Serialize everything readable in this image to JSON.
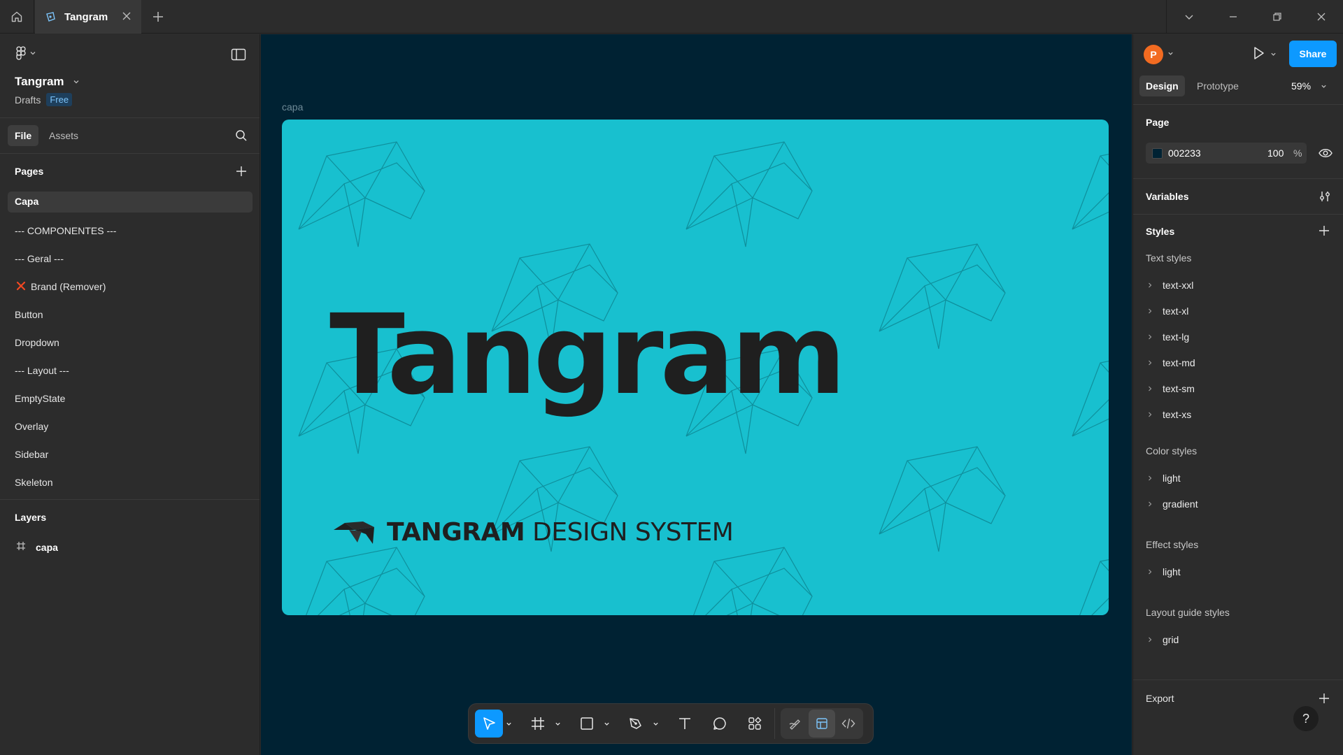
{
  "app": {
    "tab_title": "Tangram",
    "icons": [
      "home-icon",
      "figma-file-icon",
      "close-icon",
      "plus-icon",
      "chevron-down-icon",
      "minimize-icon",
      "restore-icon",
      "window-close-icon"
    ]
  },
  "left_panel": {
    "file_name": "Tangram",
    "location": "Drafts",
    "plan_badge": "Free",
    "tabs": {
      "file": "File",
      "assets": "Assets"
    },
    "pages_title": "Pages",
    "pages": [
      {
        "label": "Capa",
        "selected": true
      },
      {
        "label": "--- COMPONENTES ---"
      },
      {
        "label": "--- Geral ---"
      },
      {
        "label": "Brand (Remover)",
        "icon": "red-x-icon"
      },
      {
        "label": "Button"
      },
      {
        "label": "Dropdown"
      },
      {
        "label": "--- Layout ---"
      },
      {
        "label": "EmptyState"
      },
      {
        "label": "Overlay"
      },
      {
        "label": "Sidebar"
      },
      {
        "label": "Skeleton"
      }
    ],
    "layers_title": "Layers",
    "layers": [
      {
        "label": "capa",
        "icon": "frame-hash-icon"
      }
    ]
  },
  "canvas": {
    "background": "#002233",
    "frame_label": "capa",
    "frame_color": "#18c0cf",
    "title": "Tangram",
    "logo_bold": "TANGRAM",
    "logo_rest": " DESIGN SYSTEM"
  },
  "toolbar": {
    "tools": [
      "move-tool-icon",
      "frame-tool-icon",
      "rectangle-tool-icon",
      "pen-tool-icon",
      "text-tool-icon",
      "comment-tool-icon",
      "actions-icon"
    ],
    "active_tool": "move-tool-icon",
    "mode_tools": [
      "draw-mode-icon",
      "design-mode-icon",
      "dev-mode-icon"
    ]
  },
  "right_panel": {
    "avatar_initial": "P",
    "share_label": "Share",
    "tabs": {
      "design": "Design",
      "prototype": "Prototype"
    },
    "zoom": "59%",
    "page_section": {
      "title": "Page",
      "color_hex": "002233",
      "opacity": "100",
      "opacity_unit": "%"
    },
    "variables_title": "Variables",
    "styles_title": "Styles",
    "text_styles_title": "Text styles",
    "text_styles": [
      "text-xxl",
      "text-xl",
      "text-lg",
      "text-md",
      "text-sm",
      "text-xs"
    ],
    "color_styles_title": "Color styles",
    "color_styles": [
      "light",
      "gradient"
    ],
    "effect_styles_title": "Effect styles",
    "effect_styles": [
      "light"
    ],
    "layout_styles_title": "Layout guide styles",
    "layout_styles": [
      "grid"
    ],
    "export_title": "Export",
    "help_label": "?"
  }
}
